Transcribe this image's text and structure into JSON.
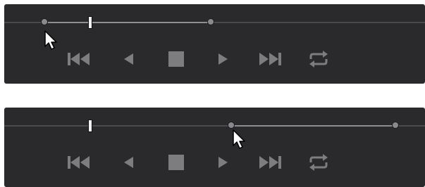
{
  "colors": {
    "panel_bg": "#2a2a2c",
    "icon": "#7d7d80",
    "handle": "#8a8a8e",
    "range": "#8e8e92",
    "track": "#4a4a4d",
    "playhead": "#f2f2f2"
  },
  "panels": [
    {
      "state": "dragging-in-point",
      "in_point": 0.095,
      "out_point": 0.49,
      "playhead": 0.205
    },
    {
      "state": "dragging-in-point",
      "in_point": 0.54,
      "out_point": 0.93,
      "playhead": 0.205
    }
  ],
  "controls": [
    {
      "name": "jump-to-start-icon"
    },
    {
      "name": "step-back-icon"
    },
    {
      "name": "stop-icon"
    },
    {
      "name": "play-icon"
    },
    {
      "name": "jump-to-end-icon"
    },
    {
      "name": "loop-icon"
    }
  ]
}
